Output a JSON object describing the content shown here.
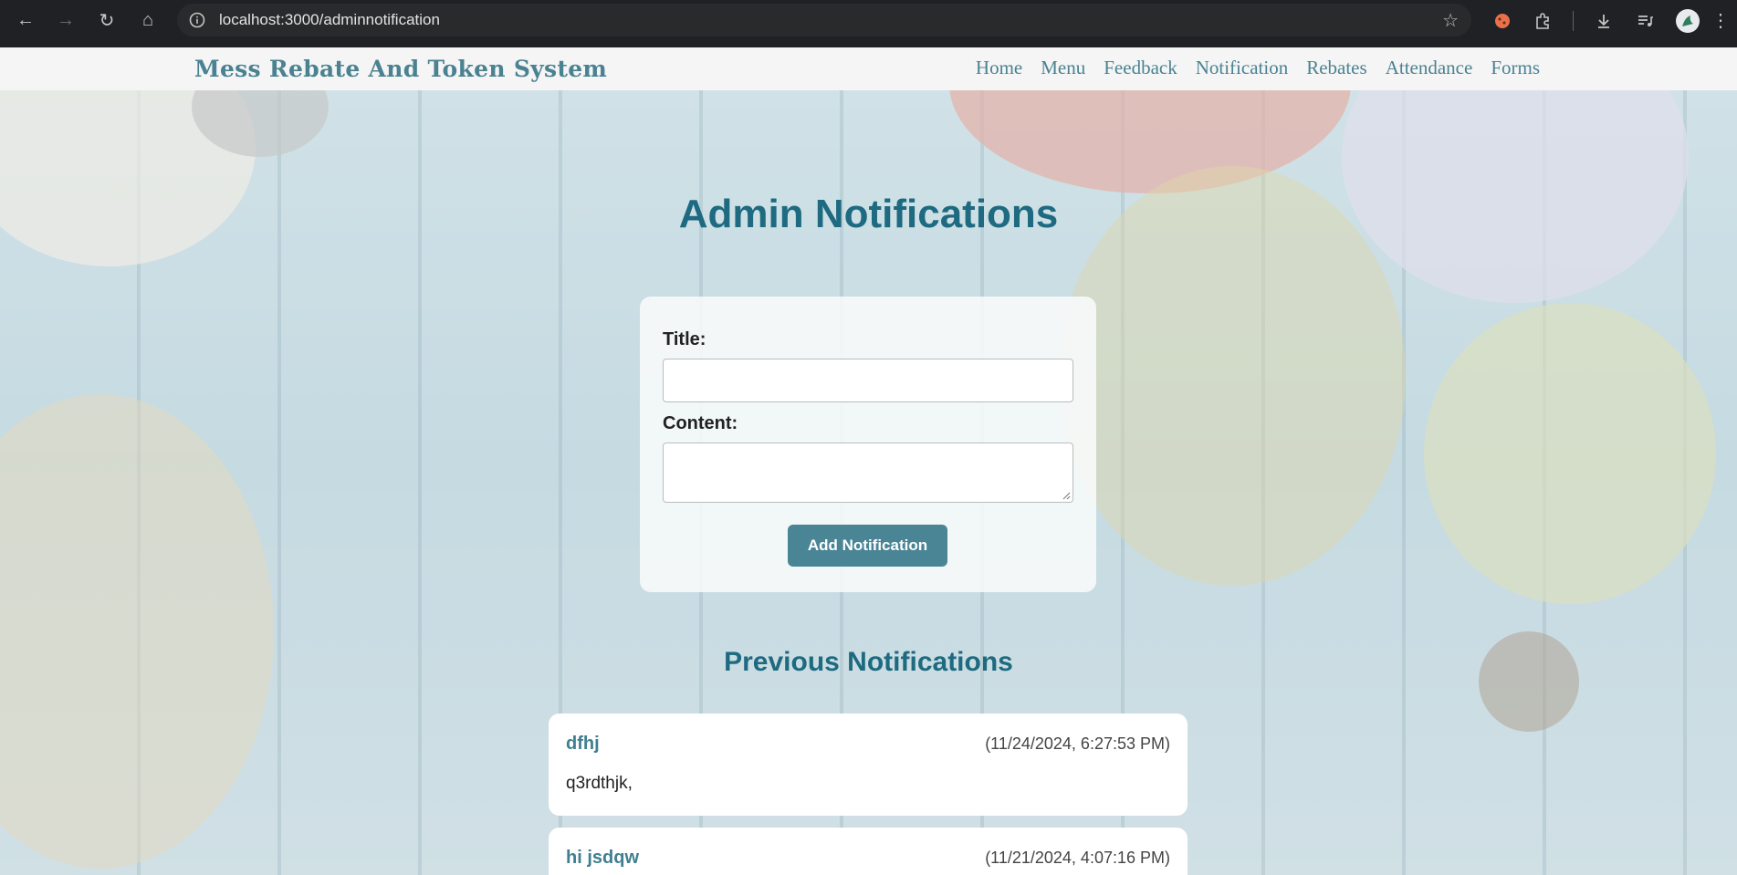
{
  "browser": {
    "url": "localhost:3000/adminnotification",
    "back_icon": "arrow-left-icon",
    "forward_icon": "arrow-right-icon",
    "reload_icon": "reload-icon",
    "home_icon": "home-icon"
  },
  "site": {
    "brand": "Mess Rebate And Token System",
    "nav": [
      "Home",
      "Menu",
      "Feedback",
      "Notification",
      "Rebates",
      "Attendance",
      "Forms"
    ]
  },
  "main": {
    "heading": "Admin Notifications",
    "form": {
      "title_label": "Title:",
      "title_value": "",
      "content_label": "Content:",
      "content_value": "",
      "submit_label": "Add Notification"
    },
    "previous_heading": "Previous Notifications",
    "notifications": [
      {
        "title": "dfhj",
        "date": "(11/24/2024, 6:27:53 PM)",
        "content": "q3rdthjk,"
      },
      {
        "title": "hi jsdqw",
        "date": "(11/21/2024, 4:07:16 PM)",
        "content": ""
      }
    ]
  },
  "colors": {
    "accent": "#1e6a80",
    "button": "#4a8595",
    "brand": "#4a8292"
  }
}
